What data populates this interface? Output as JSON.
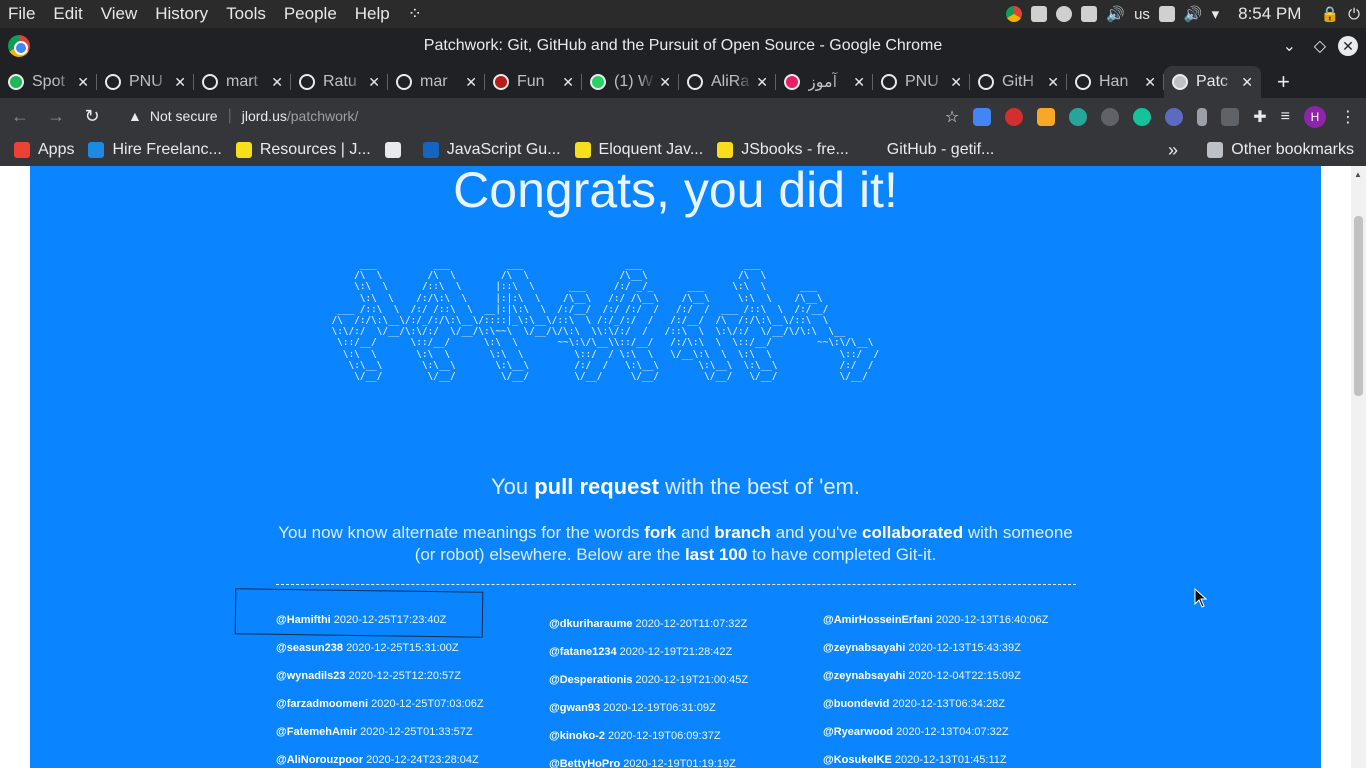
{
  "os": {
    "menu": [
      "File",
      "Edit",
      "View",
      "History",
      "Tools",
      "People",
      "Help"
    ],
    "lang": "us",
    "clock": "8:54 PM"
  },
  "window": {
    "title": "Patchwork: Git, GitHub and the Pursuit of Open Source - Google Chrome"
  },
  "tabs": [
    {
      "label": "Spot",
      "color": "#1db954"
    },
    {
      "label": "PNU",
      "color": "#202124"
    },
    {
      "label": "mart",
      "color": "#202124"
    },
    {
      "label": "Ratu",
      "color": "#202124"
    },
    {
      "label": "mar",
      "color": "#202124"
    },
    {
      "label": "Fun",
      "color": "#b71c1c"
    },
    {
      "label": "(1) W",
      "color": "#25d366"
    },
    {
      "label": "AliRa",
      "color": "#202124"
    },
    {
      "label": "آموز",
      "color": "#e91e63"
    },
    {
      "label": "PNU",
      "color": "#202124"
    },
    {
      "label": "GitH",
      "color": "#202124"
    },
    {
      "label": "Han",
      "color": "#202124"
    },
    {
      "label": "Patc",
      "color": "#bdc1c6",
      "active": true
    }
  ],
  "address": {
    "security": "Not secure",
    "host": "jlord.us",
    "path": "/patchwork/"
  },
  "bookmarks": [
    {
      "label": "Apps",
      "color": "#ea4335"
    },
    {
      "label": "Hire Freelanc...",
      "color": "#1e88e5"
    },
    {
      "label": "Resources | J...",
      "color": "#f7df1e"
    },
    {
      "label": "",
      "color": "#e8eaed"
    },
    {
      "label": "JavaScript Gu...",
      "color": "#1565c0"
    },
    {
      "label": "Eloquent Jav...",
      "color": "#f7df1e"
    },
    {
      "label": "JSbooks - fre...",
      "color": "#f7df1e"
    },
    {
      "label": "GitHub - getif...",
      "color": "#35363a"
    }
  ],
  "bookmarks_more": "»",
  "other_bookmarks": "Other bookmarks",
  "page": {
    "heading": "Congrats, you did it!",
    "tagline_pre": "You ",
    "tagline_bold": "pull request",
    "tagline_post": " with the best of 'em.",
    "para": {
      "t1": "You now know alternate meanings for the words ",
      "b1": "fork",
      "t2": " and ",
      "b2": "branch",
      "t3": " and you've ",
      "b3": "collaborated",
      "t4": " with someone (or robot) elsewhere. Below are the ",
      "b4": "last 100",
      "t5": " to have completed Git-it."
    },
    "columns": [
      [
        {
          "user": "@Hamifthi",
          "time": "2020-12-25T17:23:40Z"
        },
        {
          "user": "@seasun238",
          "time": "2020-12-25T15:31:00Z"
        },
        {
          "user": "@wynadils23",
          "time": "2020-12-25T12:20:57Z"
        },
        {
          "user": "@farzadmoomeni",
          "time": "2020-12-25T07:03:06Z"
        },
        {
          "user": "@FatemehAmir",
          "time": "2020-12-25T01:33:57Z"
        },
        {
          "user": "@AliNorouzpoor",
          "time": "2020-12-24T23:28:04Z"
        }
      ],
      [
        {
          "user": "@dkuriharaume",
          "time": "2020-12-20T11:07:32Z"
        },
        {
          "user": "@fatane1234",
          "time": "2020-12-19T21:28:42Z"
        },
        {
          "user": "@Desperationis",
          "time": "2020-12-19T21:00:45Z"
        },
        {
          "user": "@gwan93",
          "time": "2020-12-19T06:31:09Z"
        },
        {
          "user": "@kinoko-2",
          "time": "2020-12-19T06:09:37Z"
        },
        {
          "user": "@BettyHoPro",
          "time": "2020-12-19T01:19:19Z"
        }
      ],
      [
        {
          "user": "@AmirHosseinErfani",
          "time": "2020-12-13T16:40:06Z"
        },
        {
          "user": "@zeynabsayahi",
          "time": "2020-12-13T15:43:39Z"
        },
        {
          "user": "@zeynabsayahi",
          "time": "2020-12-04T22:15:09Z"
        },
        {
          "user": "@buondevid",
          "time": "2020-12-13T06:34:28Z"
        },
        {
          "user": "@Ryearwood",
          "time": "2020-12-13T04:07:32Z"
        },
        {
          "user": "@KosukeIKE",
          "time": "2020-12-13T01:45:11Z"
        }
      ]
    ]
  }
}
